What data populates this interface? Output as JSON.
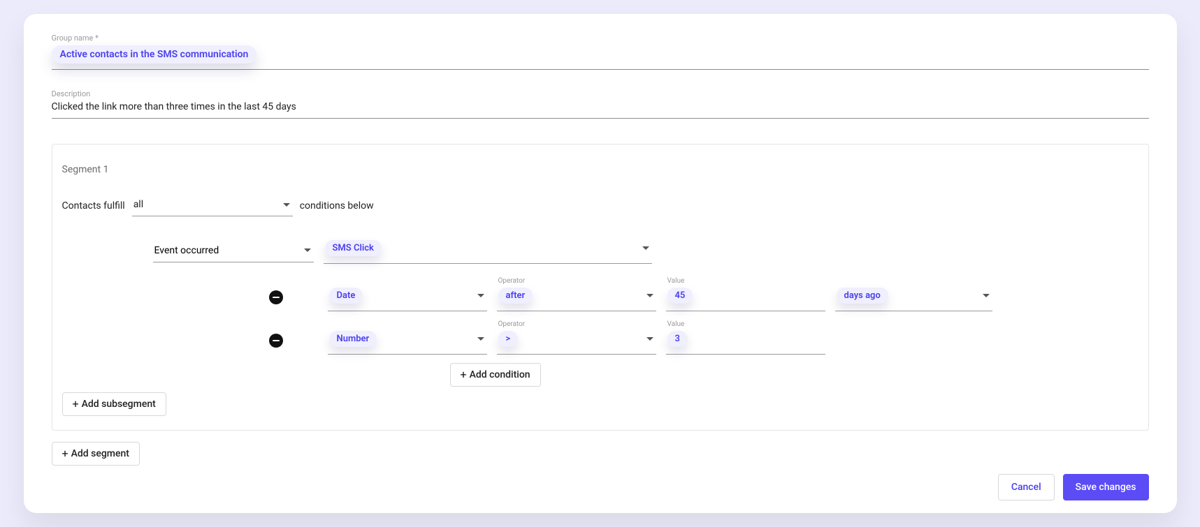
{
  "group": {
    "label": "Group name *",
    "value": "Active contacts in the SMS communication"
  },
  "description": {
    "label": "Description",
    "value": "Clicked the link more than three times in the last 45 days"
  },
  "segment": {
    "title": "Segment 1",
    "fulfill": {
      "prefix": "Contacts fulfill",
      "operator_value": "all",
      "suffix": "conditions below"
    },
    "event": {
      "type_value": "Event occurred",
      "name_value": "SMS Click"
    },
    "conditions": [
      {
        "field": "Date",
        "operator_label": "Operator",
        "operator": "after",
        "value_label": "Value",
        "value": "45",
        "unit": "days ago"
      },
      {
        "field": "Number",
        "operator_label": "Operator",
        "operator": ">",
        "value_label": "Value",
        "value": "3",
        "unit": null
      }
    ],
    "add_condition": "Add condition"
  },
  "add_subsegment": "Add subsegment",
  "add_segment": "Add segment",
  "actions": {
    "cancel": "Cancel",
    "save": "Save changes"
  }
}
